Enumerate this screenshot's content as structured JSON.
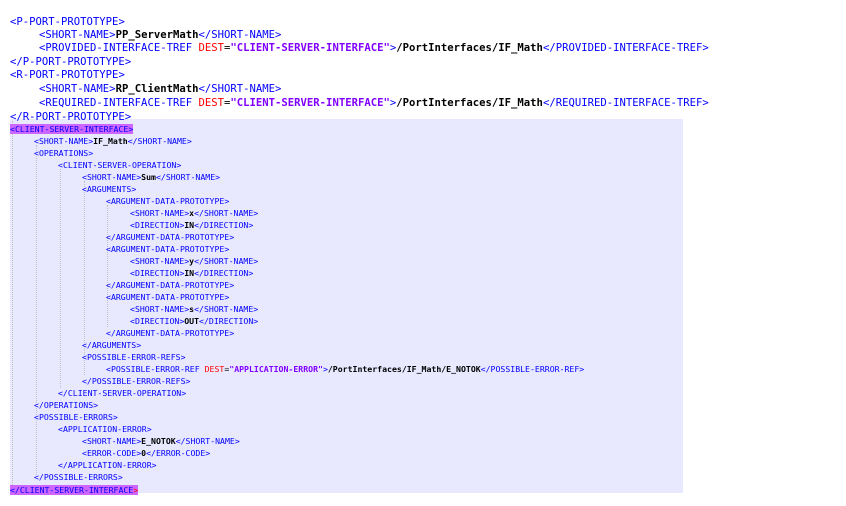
{
  "editor": {
    "lines": [
      {
        "o": "<",
        "t": "P-PORT-PROTOTYPE",
        "c": ">"
      },
      {
        "o": "<",
        "t": "SHORT-NAME",
        "c": ">",
        "v": "PP_ServerMath",
        "et": "SHORT-NAME"
      },
      {
        "o": "<",
        "t": "PROVIDED-INTERFACE-TREF",
        "a": "DEST",
        "s": "\"CLIENT-SERVER-INTERFACE\"",
        "c": ">",
        "v": "/PortInterfaces/IF_Math",
        "et": "PROVIDED-INTERFACE-TREF"
      },
      {
        "o": "</",
        "t": "P-PORT-PROTOTYPE",
        "c": ">"
      },
      {
        "o": "<",
        "t": "R-PORT-PROTOTYPE",
        "c": ">"
      },
      {
        "o": "<",
        "t": "SHORT-NAME",
        "c": ">",
        "v": "RP_ClientMath",
        "et": "SHORT-NAME"
      },
      {
        "o": "<",
        "t": "REQUIRED-INTERFACE-TREF",
        "a": "DEST",
        "s": "\"CLIENT-SERVER-INTERFACE\"",
        "c": ">",
        "v": "/PortInterfaces/IF_Math",
        "et": "REQUIRED-INTERFACE-TREF"
      },
      {
        "o": "</",
        "t": "R-PORT-PROTOTYPE",
        "c": ">"
      },
      {
        "o": "<",
        "t": "CLIENT-SERVER-INTERFACE",
        "c": ">"
      },
      {
        "o": "<",
        "t": "SHORT-NAME",
        "c": ">",
        "v": "IF_Math",
        "et": "SHORT-NAME"
      },
      {
        "o": "<",
        "t": "OPERATIONS",
        "c": ">"
      },
      {
        "o": "<",
        "t": "CLIENT-SERVER-OPERATION",
        "c": ">"
      },
      {
        "o": "<",
        "t": "SHORT-NAME",
        "c": ">",
        "v": "Sum",
        "et": "SHORT-NAME"
      },
      {
        "o": "<",
        "t": "ARGUMENTS",
        "c": ">"
      },
      {
        "o": "<",
        "t": "ARGUMENT-DATA-PROTOTYPE",
        "c": ">"
      },
      {
        "o": "<",
        "t": "SHORT-NAME",
        "c": ">",
        "v": "x",
        "et": "SHORT-NAME"
      },
      {
        "o": "<",
        "t": "DIRECTION",
        "c": ">",
        "v": "IN",
        "et": "DIRECTION"
      },
      {
        "o": "</",
        "t": "ARGUMENT-DATA-PROTOTYPE",
        "c": ">"
      },
      {
        "o": "<",
        "t": "ARGUMENT-DATA-PROTOTYPE",
        "c": ">"
      },
      {
        "o": "<",
        "t": "SHORT-NAME",
        "c": ">",
        "v": "y",
        "et": "SHORT-NAME"
      },
      {
        "o": "<",
        "t": "DIRECTION",
        "c": ">",
        "v": "IN",
        "et": "DIRECTION"
      },
      {
        "o": "</",
        "t": "ARGUMENT-DATA-PROTOTYPE",
        "c": ">"
      },
      {
        "o": "<",
        "t": "ARGUMENT-DATA-PROTOTYPE",
        "c": ">"
      },
      {
        "o": "<",
        "t": "SHORT-NAME",
        "c": ">",
        "v": "s",
        "et": "SHORT-NAME"
      },
      {
        "o": "<",
        "t": "DIRECTION",
        "c": ">",
        "v": "OUT",
        "et": "DIRECTION"
      },
      {
        "o": "</",
        "t": "ARGUMENT-DATA-PROTOTYPE",
        "c": ">"
      },
      {
        "o": "</",
        "t": "ARGUMENTS",
        "c": ">"
      },
      {
        "o": "<",
        "t": "POSSIBLE-ERROR-REFS",
        "c": ">"
      },
      {
        "o": "<",
        "t": "POSSIBLE-ERROR-REF",
        "a": "DEST",
        "s": "\"APPLICATION-ERROR\"",
        "c": ">",
        "v": "/PortInterfaces/IF_Math/E_NOTOK",
        "et": "POSSIBLE-ERROR-REF"
      },
      {
        "o": "</",
        "t": "POSSIBLE-ERROR-REFS",
        "c": ">"
      },
      {
        "o": "</",
        "t": "CLIENT-SERVER-OPERATION",
        "c": ">"
      },
      {
        "o": "</",
        "t": "OPERATIONS",
        "c": ">"
      },
      {
        "o": "<",
        "t": "POSSIBLE-ERRORS",
        "c": ">"
      },
      {
        "o": "<",
        "t": "APPLICATION-ERROR",
        "c": ">"
      },
      {
        "o": "<",
        "t": "SHORT-NAME",
        "c": ">",
        "v": "E_NOTOK",
        "et": "SHORT-NAME"
      },
      {
        "o": "<",
        "t": "ERROR-CODE",
        "c": ">",
        "v": "0",
        "et": "ERROR-CODE"
      },
      {
        "o": "</",
        "t": "APPLICATION-ERROR",
        "c": ">"
      },
      {
        "o": "</",
        "t": "POSSIBLE-ERRORS",
        "c": ">"
      },
      {
        "o": "</",
        "t": "CLIENT-SERVER-INTERFACE",
        "c": ">"
      }
    ]
  },
  "colors": {
    "tag": "#0000ff",
    "attribute": "#ff0000",
    "string": "#8000ff",
    "text": "#000000",
    "tag_highlight": "#cc66ff",
    "block_highlight": "#e8e8ff"
  }
}
